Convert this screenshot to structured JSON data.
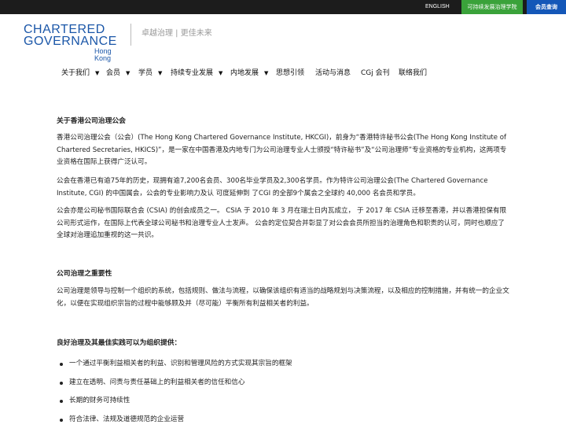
{
  "topbar": {
    "english_label": "ENGLISH",
    "academy_label": "可持续发展治理学院",
    "member_login_label": "会员查询"
  },
  "logo": {
    "line1": "CHARTERED",
    "line2": "GOVERNANCE",
    "line3": "Hong Kong"
  },
  "tagline": "卓越治理 | 更佳未来",
  "nav": {
    "items": [
      {
        "label": "关于我们",
        "has_dropdown": true
      },
      {
        "label": "会员",
        "has_dropdown": true
      },
      {
        "label": "学员",
        "has_dropdown": true
      },
      {
        "label": "持续专业发展",
        "has_dropdown": true
      },
      {
        "label": "内地发展",
        "has_dropdown": true
      },
      {
        "label": "思想引领",
        "has_dropdown": false
      },
      {
        "label": "活动与消息",
        "has_dropdown": false
      },
      {
        "label": "CGj 会刊",
        "has_dropdown": false
      },
      {
        "label": "联络我们",
        "has_dropdown": false
      }
    ]
  },
  "sections": {
    "about_heading": "关于香港公司治理公会",
    "about_p1": "香港公司治理公会（公会）(The Hong Kong Chartered Governance Institute, HKCGI)，前身为“香港特许秘书公会(The Hong Kong Institute of Chartered Secretaries, HKICS)”，是一家在中国香港及内地专门为公司治理专业人士颁授“特许秘书”及“公司治理师”专业资格的专业机构，这两项专业资格在国际上获得广泛认可。",
    "about_p2": "公会在香港已有逾75年的历史，现拥有逾7,200名会员、300名毕业学员及2,300名学员。作为特许公司治理公会(The Chartered Governance Institute, CGI) 的中国属会，公会的专业影响力及认 可度延伸到 了CGI 的全部9个属会之全球约 40,000 名会员和学员。",
    "about_p3": "公会亦是公司秘书国际联合会 (CSIA) 的创会成员之一。 CSIA 于 2010 年 3 月在瑞士日内瓦成立， 于 2017 年 CSIA 迁移至香港，并以香港担保有限公司形式运作，在国际上代表全球公司秘书和治理专业人士发声。 公会的定位契合并彰显了对公会会员所担当的治理角色和职责的认可，同时也顺应了全球对治理追加重视的这一共识。",
    "importance_heading": "公司治理之重要性",
    "importance_p1": "公司治理是领导与控制一个组织的系统，包括规则、做法与流程，以确保该组织有适当的战略规划与决策流程，以及相应的控制措施，并有统一的企业文化，以便在实现组织宗旨的过程中能够顾及并（尽可能）平衡所有利益相关者的利益。",
    "benefits_heading": "良好治理及其最佳实践可以为组织提供：",
    "benefits": [
      "一个通过平衡利益相关者的利益、识别和管理风险的方式实现其宗旨的框架",
      "建立在透明、问责与责任基础上的利益相关者的信任和信心",
      "长期的财务可持续性",
      "符合法律、法规及道德规范的企业运营"
    ]
  },
  "colors": {
    "topbar_bg": "#1c1c1c",
    "academy_green": "#3aa23a",
    "member_blue": "#1457b8",
    "brand_blue": "#1a56a8",
    "brand_red": "#e3342f"
  }
}
